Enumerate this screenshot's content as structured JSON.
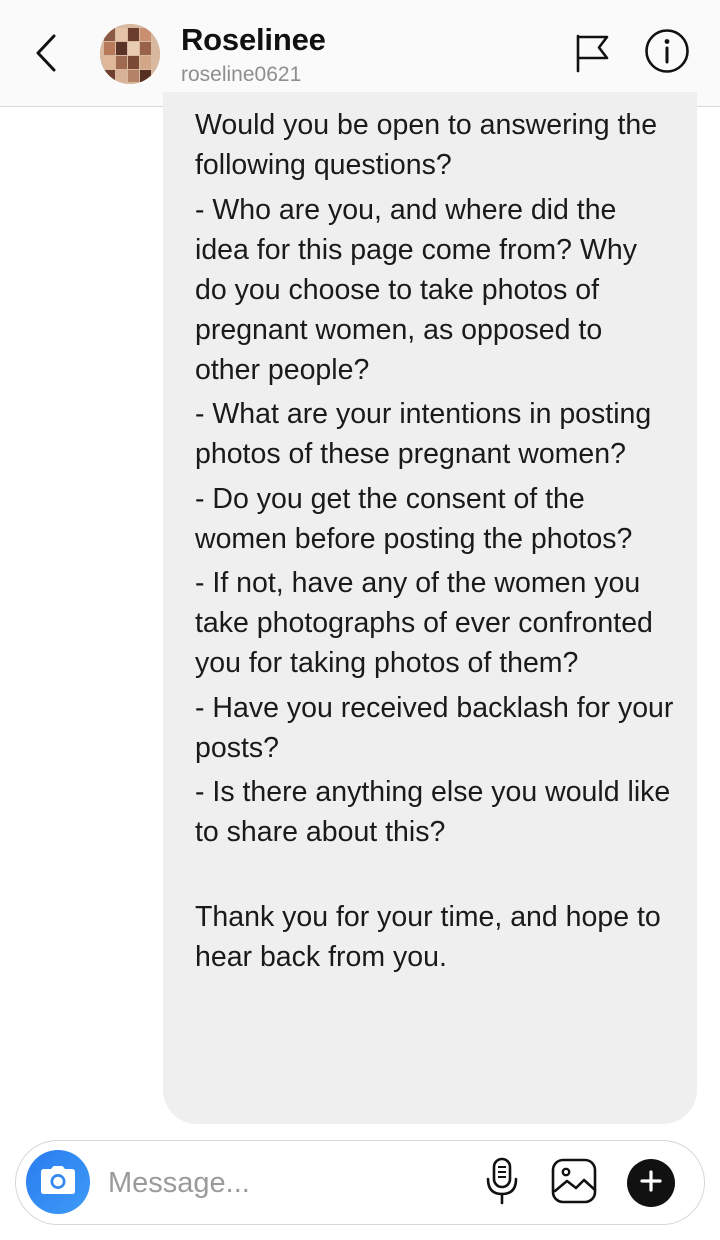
{
  "header": {
    "name": "Roselinee",
    "handle": "roseline0621",
    "icons": {
      "back": "chevron-left-icon",
      "flag": "flag-icon",
      "info": "info-icon"
    }
  },
  "message": {
    "paragraphs": [
      "Would you be open to answering the following questions?",
      "- Who are you, and where did the idea for this page come from? Why do you choose to take photos of pregnant women, as opposed to other people?",
      "- What are your intentions in posting photos of these pregnant women?",
      "- Do you get the consent of the women before posting the photos?",
      "- If not, have any of the women you take photographs of ever confronted you for taking photos of them?",
      "- Have you received backlash for your posts?",
      "- Is there anything else you would like to share about this?",
      "Thank you for your time, and hope to hear back from you."
    ]
  },
  "composer": {
    "placeholder": "Message...",
    "value": "",
    "icons": {
      "camera": "camera-icon",
      "mic": "microphone-icon",
      "gallery": "gallery-icon",
      "plus": "plus-icon"
    }
  },
  "colors": {
    "bubble": "#efefef",
    "camera_button": "#3897f0",
    "placeholder": "#9a9a9a",
    "handle": "#8e8e8e"
  }
}
